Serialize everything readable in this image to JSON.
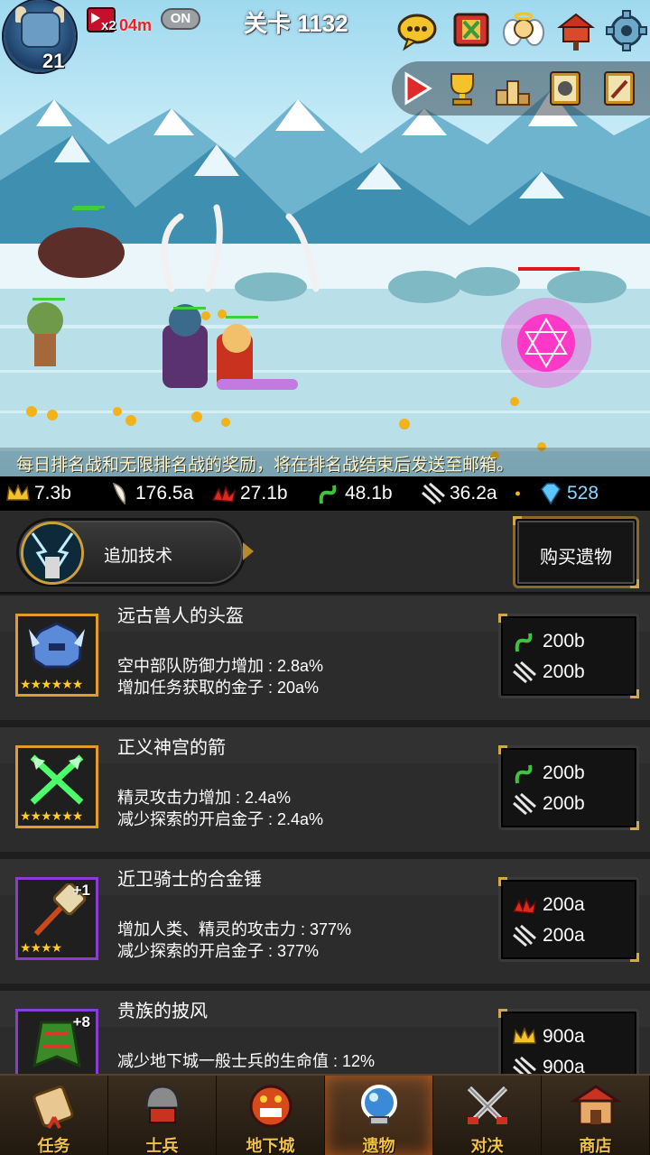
{
  "header": {
    "player_level": "21",
    "speed_multiplier": "x2",
    "speed_timer": "04m",
    "auto_toggle": "ON",
    "stage_title": "关卡 1132"
  },
  "ticker": "每日排名战和无限排名战的奖励，将在排名战结束后发送至邮箱。",
  "resources": [
    {
      "icon": "crown-icon",
      "value": "7.3b"
    },
    {
      "icon": "tooth-icon",
      "value": "176.5a"
    },
    {
      "icon": "red-gem-icon",
      "value": "27.1b"
    },
    {
      "icon": "green-vine-icon",
      "value": "48.1b"
    },
    {
      "icon": "claw-icon",
      "value": "36.2a"
    },
    {
      "icon": "gold-coin-icon",
      "value": ""
    },
    {
      "icon": "diamond-icon",
      "value": "528"
    }
  ],
  "tech": {
    "add_tech_label": "追加技术",
    "buy_relic_label": "购买遗物"
  },
  "relics": [
    {
      "name": "远古兽人的头盔",
      "desc1": "空中部队防御力增加 : 2.8a%",
      "desc2": "增加任务获取的金子 : 20a%",
      "stars": "★★★★★★",
      "plus": "",
      "cost1": "200b",
      "cost2": "200b"
    },
    {
      "name": "正义神宫的箭",
      "desc1": "精灵攻击力增加 : 2.4a%",
      "desc2": "减少探索的开启金子 : 2.4a%",
      "stars": "★★★★★★",
      "plus": "",
      "cost1": "200b",
      "cost2": "200b"
    },
    {
      "name": "近卫骑士的合金锤",
      "desc1": "增加人类、精灵的攻击力 : 377%",
      "desc2": "减少探索的开启金子 : 377%",
      "stars": "★★★★",
      "plus": "+1",
      "cost1": "200a",
      "cost2": "200a"
    },
    {
      "name": "贵族的披风",
      "desc1": "减少地下城一般士兵的生命值 : 12%",
      "desc2": "",
      "stars": "",
      "plus": "+8",
      "cost1": "900a",
      "cost2": "900a"
    }
  ],
  "nav": [
    {
      "label": "任务",
      "icon": "scroll-icon"
    },
    {
      "label": "士兵",
      "icon": "soldier-helmet-icon"
    },
    {
      "label": "地下城",
      "icon": "monster-face-icon"
    },
    {
      "label": "遗物",
      "icon": "orb-relic-icon"
    },
    {
      "label": "对决",
      "icon": "crossed-swords-icon"
    },
    {
      "label": "商店",
      "icon": "shop-icon"
    }
  ],
  "colors": {
    "gold_text": "#f2c14a",
    "frame_orange": "#e39b2a",
    "frame_purple": "#8b3bd6",
    "diamond": "#8ad7ff"
  }
}
